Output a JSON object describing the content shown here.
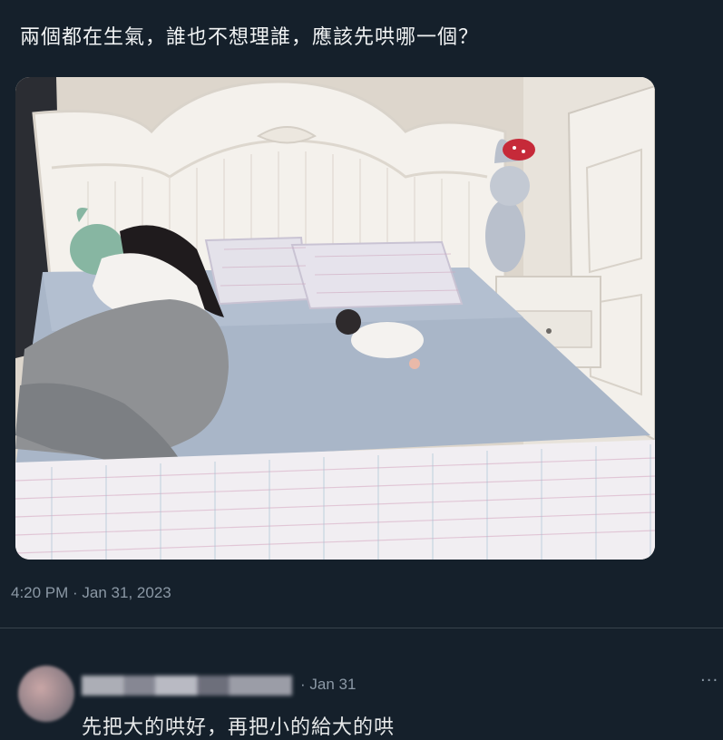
{
  "tweet": {
    "text": "兩個都在生氣，誰也不想理誰，應該先哄哪一個？",
    "timestamp": "4:20 PM · Jan 31, 2023"
  },
  "reply": {
    "date": "· Jan 31",
    "more_icon": "more-icon",
    "more_label": "···",
    "text": "先把大的哄好，再把小的給大的哄"
  },
  "colors": {
    "background": "#15202b",
    "text": "#e7e9ea",
    "muted": "#8b98a5",
    "divider": "#38444d"
  }
}
